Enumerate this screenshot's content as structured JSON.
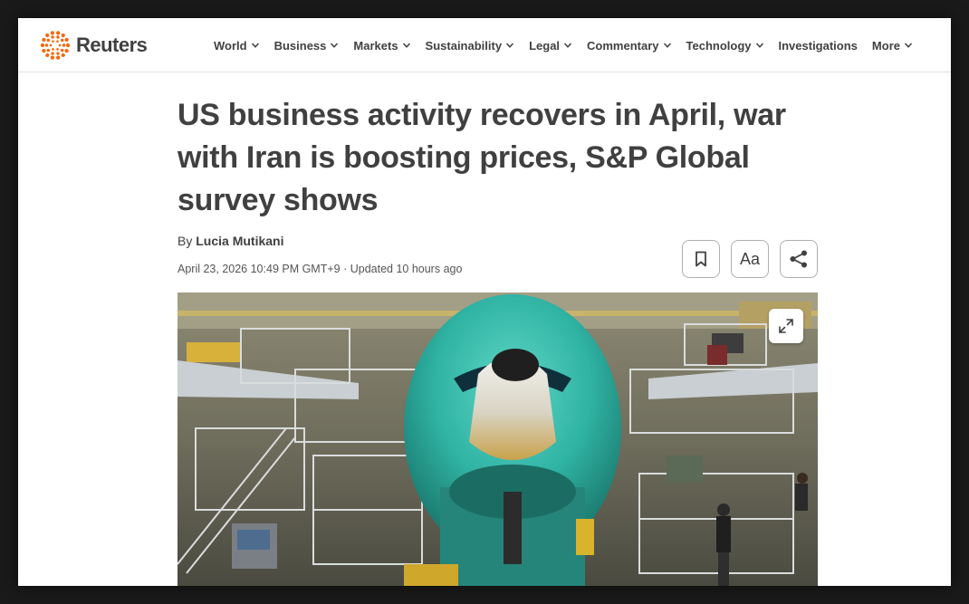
{
  "brand": {
    "name": "Reuters",
    "accent": "#fa6400"
  },
  "nav": [
    {
      "label": "World",
      "has_menu": true
    },
    {
      "label": "Business",
      "has_menu": true
    },
    {
      "label": "Markets",
      "has_menu": true
    },
    {
      "label": "Sustainability",
      "has_menu": true
    },
    {
      "label": "Legal",
      "has_menu": true
    },
    {
      "label": "Commentary",
      "has_menu": true
    },
    {
      "label": "Technology",
      "has_menu": true
    },
    {
      "label": "Investigations",
      "has_menu": false
    },
    {
      "label": "More",
      "has_menu": true
    }
  ],
  "article": {
    "headline": "US business activity recovers in April, war with Iran is boosting prices, S&P Global survey shows",
    "by_prefix": "By",
    "author": "Lucia Mutikani",
    "dateline": "April 23, 2026 10:49 PM GMT+9 · Updated 10 hours ago"
  },
  "tools": {
    "bookmark_icon": "bookmark-icon",
    "text_size_label": "Aa",
    "share_icon": "share-icon"
  },
  "hero_image": {
    "expand_icon": "expand-icon"
  }
}
